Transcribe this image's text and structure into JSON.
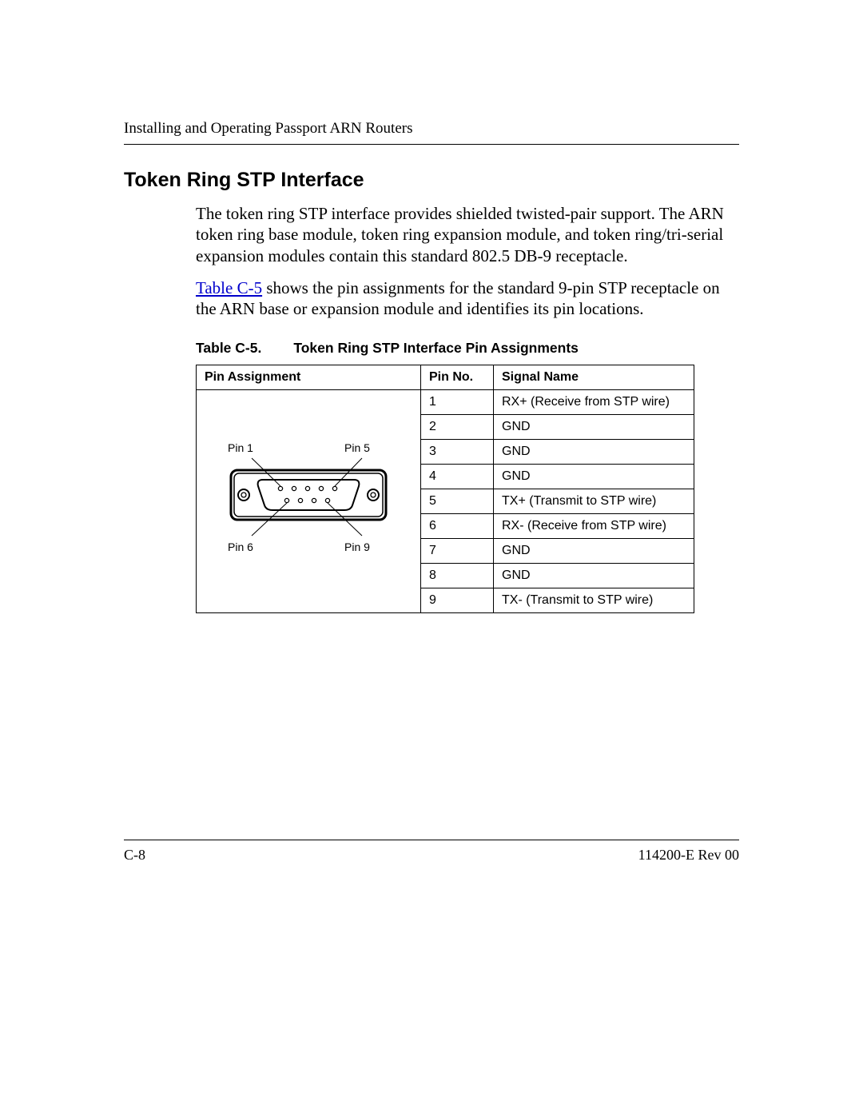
{
  "header": {
    "running_head": "Installing and Operating Passport ARN Routers"
  },
  "section": {
    "title": "Token Ring STP Interface",
    "para1": "The token ring STP interface provides shielded twisted-pair support. The ARN token ring base module, token ring expansion module, and token ring/tri-serial expansion modules contain this standard 802.5 DB-9 receptacle.",
    "para2_link": "Table C-5",
    "para2_rest": " shows the pin assignments for the standard 9-pin STP receptacle on the ARN base or expansion module and identifies its pin locations."
  },
  "table": {
    "caption_num": "Table C-5.",
    "caption_title": "Token Ring STP Interface Pin Assignments",
    "headers": {
      "assign": "Pin Assignment",
      "pin": "Pin No.",
      "signal": "Signal Name"
    },
    "diagram_labels": {
      "pin1": "Pin 1",
      "pin5": "Pin 5",
      "pin6": "Pin 6",
      "pin9": "Pin 9"
    },
    "rows": [
      {
        "pin": "1",
        "signal": "RX+ (Receive from STP wire)"
      },
      {
        "pin": "2",
        "signal": "GND"
      },
      {
        "pin": "3",
        "signal": "GND"
      },
      {
        "pin": "4",
        "signal": "GND"
      },
      {
        "pin": "5",
        "signal": "TX+ (Transmit to STP wire)"
      },
      {
        "pin": "6",
        "signal": "RX- (Receive from STP wire)"
      },
      {
        "pin": "7",
        "signal": "GND"
      },
      {
        "pin": "8",
        "signal": "GND"
      },
      {
        "pin": "9",
        "signal": "TX- (Transmit to STP wire)"
      }
    ]
  },
  "footer": {
    "page": "C-8",
    "doc": "114200-E Rev 00"
  }
}
